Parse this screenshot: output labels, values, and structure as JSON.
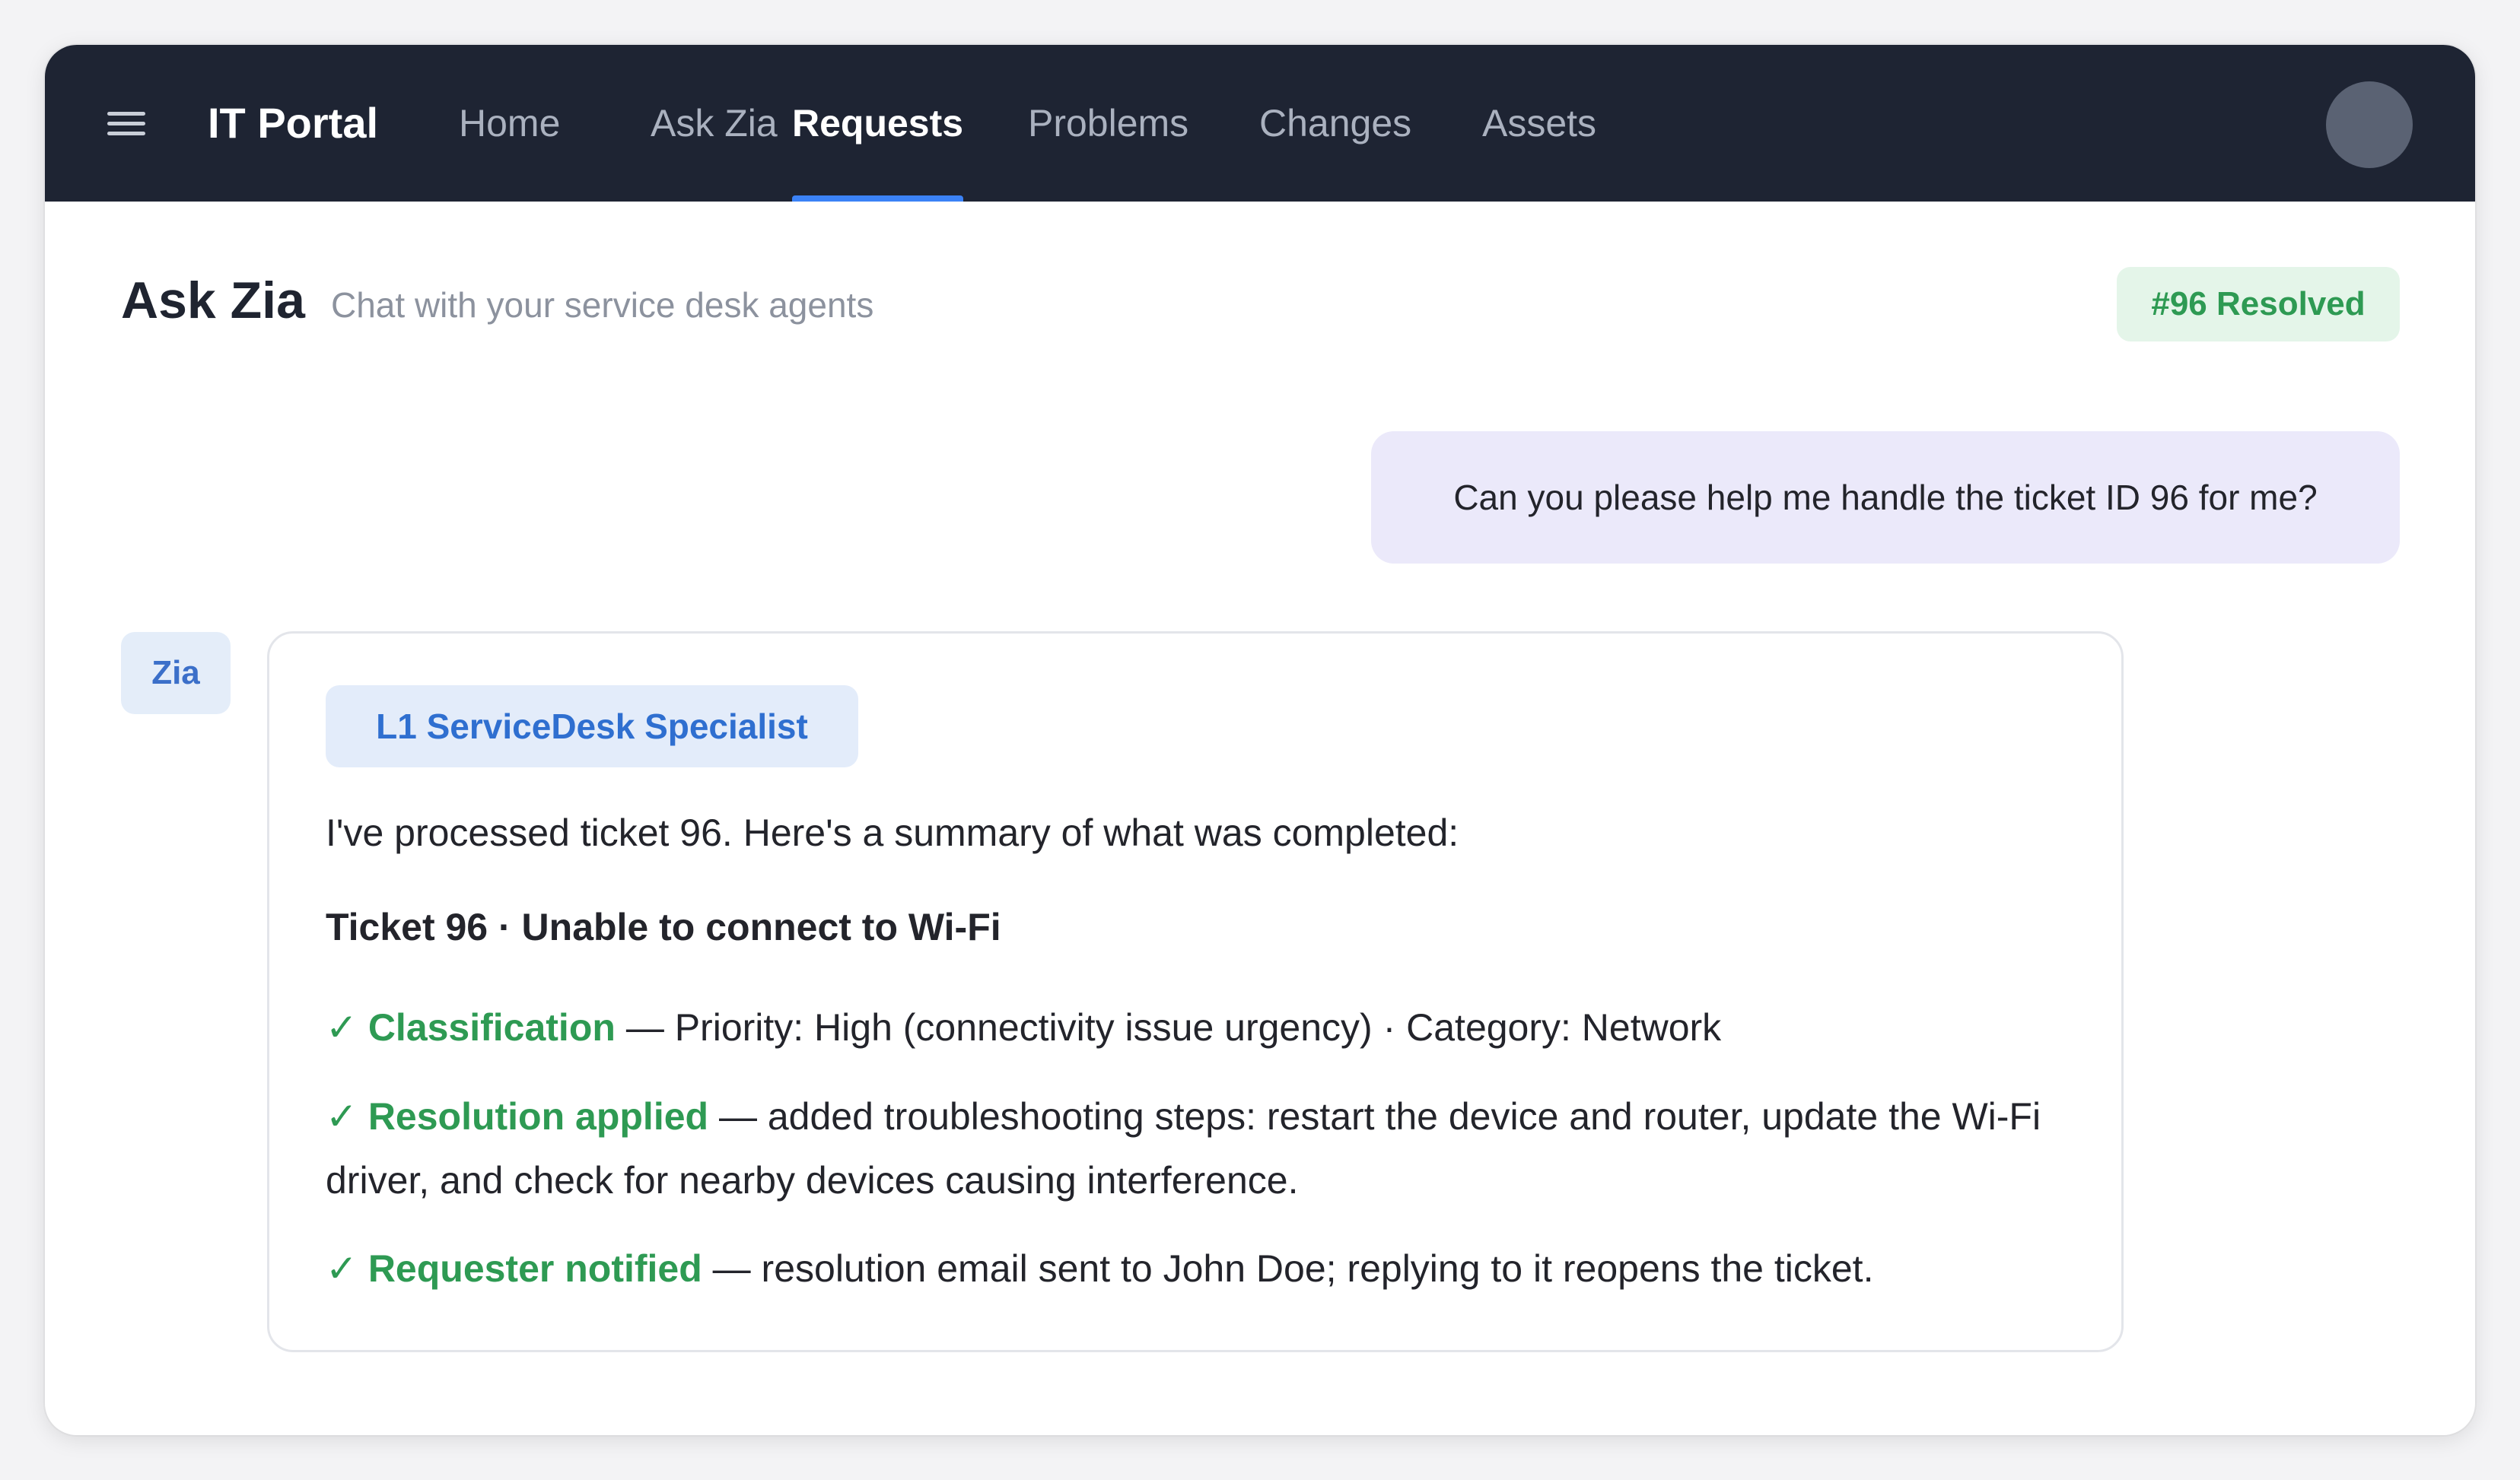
{
  "nav": {
    "brand": "IT Portal",
    "items": [
      {
        "label": "Home",
        "active": false
      },
      {
        "label": "Ask Zia",
        "active": false
      },
      {
        "label": "Requests",
        "active": true
      },
      {
        "label": "Problems",
        "active": false
      },
      {
        "label": "Changes",
        "active": false
      },
      {
        "label": "Assets",
        "active": false
      }
    ]
  },
  "header": {
    "title": "Ask Zia",
    "subtitle": "Chat with your service desk agents",
    "status_badge": "#96 Resolved"
  },
  "chat": {
    "user_message": "Can you please help me handle the ticket ID 96 for me?",
    "agent": {
      "avatar_label": "Zia",
      "role": "L1 ServiceDesk Specialist",
      "intro": "I've processed ticket 96. Here's a summary of what was completed:",
      "ticket_title": "Ticket 96 · Unable to connect to Wi-Fi",
      "steps": [
        {
          "check": "✓",
          "title": "Classification",
          "detail": " — Priority: High (connectivity issue urgency) · Category: Network"
        },
        {
          "check": "✓",
          "title": "Resolution applied",
          "detail": " — added troubleshooting steps: restart the device and router, update the Wi-Fi driver, and check for nearby devices causing interference."
        },
        {
          "check": "✓",
          "title": "Requester notified",
          "detail": " — resolution email sent to John Doe; replying to it reopens the ticket."
        }
      ]
    }
  },
  "colors": {
    "nav_background": "#1e2433",
    "accent": "#3b82f6",
    "success": "#2e9a53",
    "role_blue": "#2f6fd0",
    "user_bubble": "#ebe9fa"
  },
  "icons": {
    "menu": "hamburger-menu-icon",
    "check": "checkmark-icon"
  }
}
